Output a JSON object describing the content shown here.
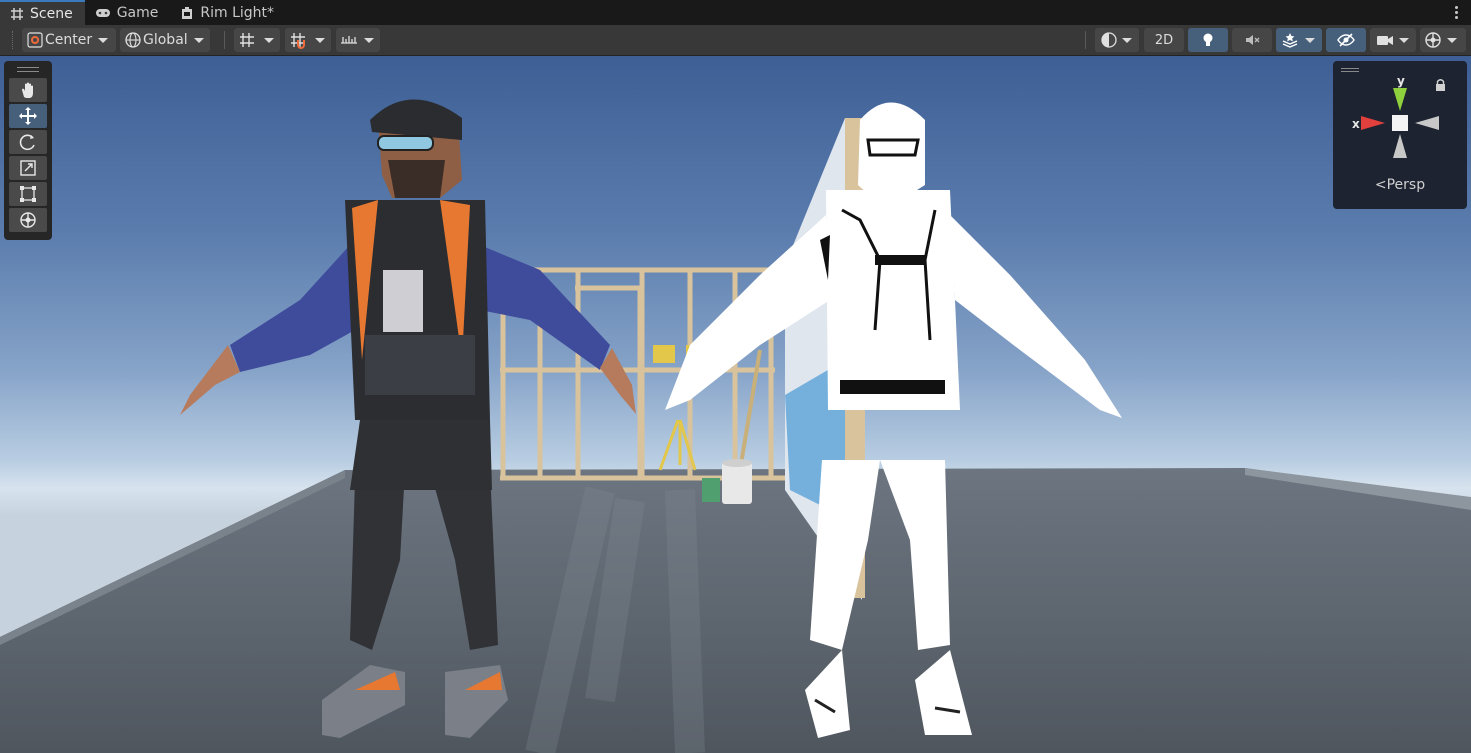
{
  "tabs": [
    {
      "label": "Scene",
      "icon": "grid-hash-icon",
      "active": true
    },
    {
      "label": "Game",
      "icon": "gamepad-icon",
      "active": false
    },
    {
      "label": "Rim Light*",
      "icon": "prefab-icon",
      "active": false
    }
  ],
  "toolbar": {
    "pivot_label": "Center",
    "space_label": "Global",
    "mode_2d_label": "2D"
  },
  "tools": [
    "hand-tool",
    "move-tool",
    "rotate-tool",
    "scale-tool",
    "rect-tool",
    "transform-tool"
  ],
  "gizmo": {
    "y_label": "y",
    "x_label": "x",
    "projection_label": "Persp"
  },
  "colors": {
    "accent": "#46607c",
    "axis_x": "#e2403d",
    "axis_y": "#8fd13c",
    "axis_z": "#3b7de0"
  }
}
